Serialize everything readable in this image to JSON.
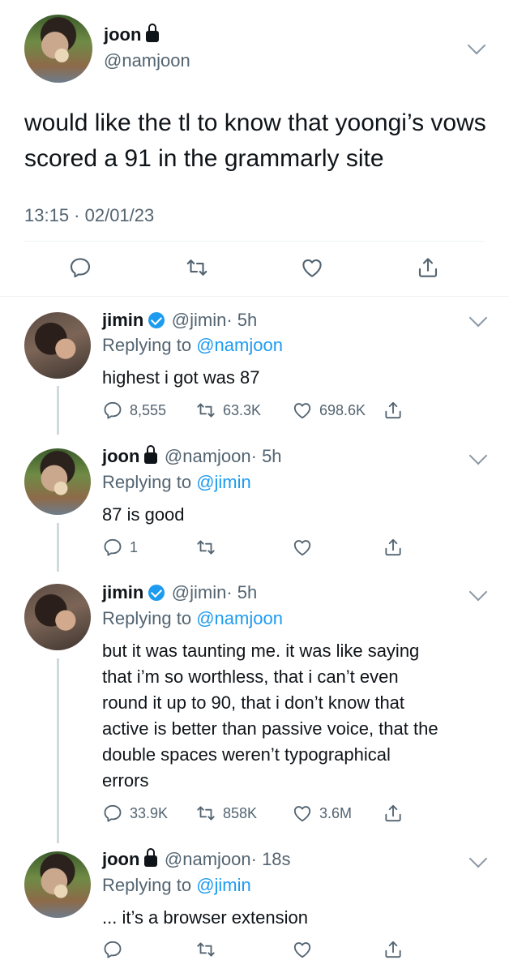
{
  "main": {
    "name": "joon",
    "handle": "@namjoon",
    "text": "would like the tl to know that yoongi’s vows scored a 91 in the grammarly site",
    "timestamp": "13:15 · 02/01/23"
  },
  "replies": [
    {
      "name": "jimin",
      "handle": "@jimin",
      "time": "· 5h",
      "replying_prefix": "Replying to",
      "replying_to": "@namjoon",
      "text": "highest i got was 87",
      "reply_count": "8,555",
      "retweet_count": "63.3K",
      "like_count": "698.6K"
    },
    {
      "name": "joon",
      "handle": "@namjoon",
      "time": "· 5h",
      "replying_prefix": "Replying to",
      "replying_to": "@jimin",
      "text": "87 is good",
      "reply_count": "1"
    },
    {
      "name": "jimin",
      "handle": "@jimin",
      "time": "· 5h",
      "replying_prefix": "Replying to",
      "replying_to": "@namjoon",
      "text_lines": [
        "but it was taunting me. it was like saying",
        "that i’m so worthless, that i can’t even",
        "round it up to 90, that i don’t know that",
        "active is better than passive voice, that the",
        "double spaces weren’t typographical",
        "errors"
      ],
      "reply_count": "33.9K",
      "retweet_count": "858K",
      "like_count": "3.6M"
    },
    {
      "name": "joon",
      "handle": "@namjoon",
      "time": "· 18s",
      "replying_prefix": "Replying to",
      "replying_to": "@jimin",
      "text": "... it’s a browser extension"
    }
  ],
  "icons": {
    "reply": "reply-icon",
    "retweet": "retweet-icon",
    "like": "like-icon",
    "share": "share-icon",
    "lock": "lock-icon",
    "verified": "verified-icon",
    "more": "chevron-down-icon"
  },
  "colors": {
    "accent": "#1d9bf0",
    "muted": "#536471",
    "line": "#cfd9de"
  }
}
